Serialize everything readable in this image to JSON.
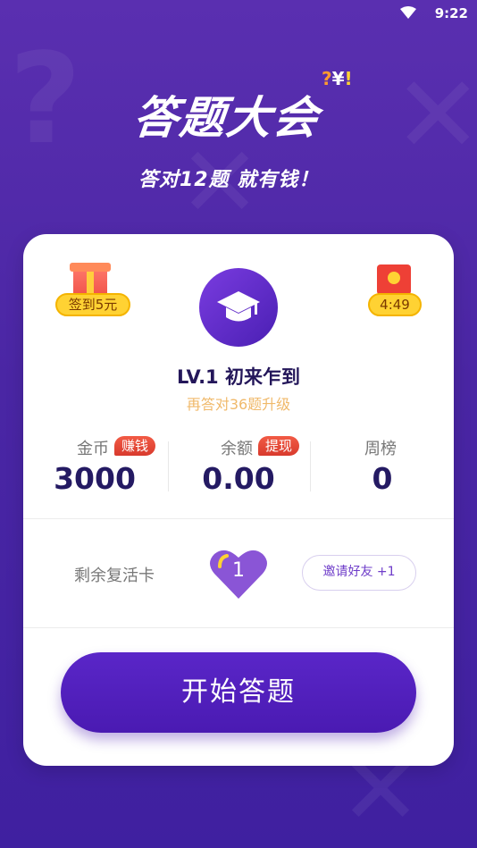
{
  "status": {
    "time": "9:22"
  },
  "app": {
    "title": "答题大会",
    "subtitle": "答对12题  就有钱！"
  },
  "card": {
    "checkin_label": "签到5元",
    "timer_label": "4:49",
    "level": "LV.1 初来乍到",
    "level_hint": "再答对36题升级",
    "stats": [
      {
        "label": "金币",
        "tag": "赚钱",
        "value": "3000"
      },
      {
        "label": "余额",
        "tag": "提现",
        "value": "0.00"
      },
      {
        "label": "周榜",
        "value": "0"
      }
    ],
    "revive_label": "剩余复活卡",
    "revive_count": "1",
    "invite_label": "邀请好友 +1",
    "start_label": "开始答题"
  },
  "colors": {
    "accent": "#4a1ab2",
    "background": "#4a26a4"
  }
}
